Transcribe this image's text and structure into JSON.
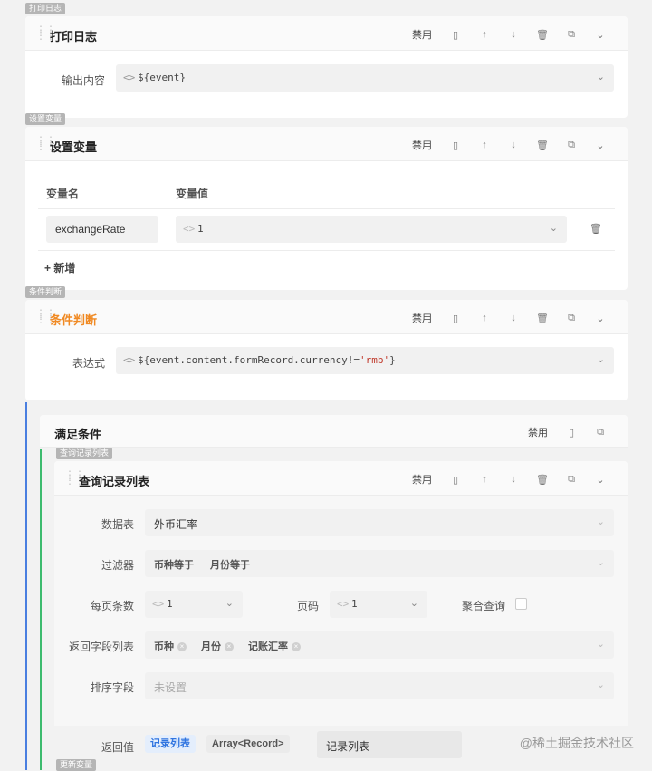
{
  "common": {
    "disable": "禁用"
  },
  "block1": {
    "tag": "打印日志",
    "title": "打印日志",
    "output_label": "输出内容",
    "output_value": "${event}"
  },
  "block2": {
    "tag": "设置变量",
    "title": "设置变量",
    "col_name": "变量名",
    "col_value": "变量值",
    "var_name": "exchangeRate",
    "var_value": "1",
    "add_label": "+ 新增"
  },
  "block3": {
    "tag": "条件判断",
    "title": "条件判断",
    "expr_label": "表达式",
    "expr_prefix": "${event.content.formRecord.currency!=",
    "expr_str": "'rmb'",
    "expr_suffix": "}"
  },
  "branch": {
    "title": "满足条件"
  },
  "block4": {
    "tag": "查询记录列表",
    "title": "查询记录列表",
    "table_label": "数据表",
    "table_value": "外币汇率",
    "filter_label": "过滤器",
    "filters": [
      "币种等于",
      "月份等于"
    ],
    "pagesize_label": "每页条数",
    "pagesize_value": "1",
    "page_label": "页码",
    "page_value": "1",
    "agg_label": "聚合查询",
    "fields_label": "返回字段列表",
    "fields": [
      "币种",
      "月份",
      "记账汇率"
    ],
    "sort_label": "排序字段",
    "sort_placeholder": "未设置",
    "return_label": "返回值",
    "return_badge": "记录列表",
    "return_type": "Array<Record>",
    "return_name": "记录列表"
  },
  "block5": {
    "tag": "更新变量"
  },
  "watermark": "@稀土掘金技术社区"
}
